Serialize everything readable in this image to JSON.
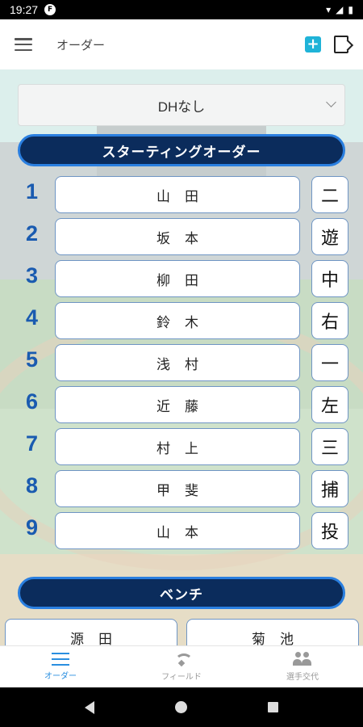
{
  "status_bar": {
    "time": "19:27",
    "app_icon": "F"
  },
  "app_bar": {
    "title": "オーダー"
  },
  "dh_select": {
    "value": "DHなし"
  },
  "starting_header": "スターティングオーダー",
  "lineup": [
    {
      "num": "1",
      "name": "山田",
      "pos": "二"
    },
    {
      "num": "2",
      "name": "坂本",
      "pos": "遊"
    },
    {
      "num": "3",
      "name": "柳田",
      "pos": "中"
    },
    {
      "num": "4",
      "name": "鈴木",
      "pos": "右"
    },
    {
      "num": "5",
      "name": "浅村",
      "pos": "一"
    },
    {
      "num": "6",
      "name": "近藤",
      "pos": "左"
    },
    {
      "num": "7",
      "name": "村上",
      "pos": "三"
    },
    {
      "num": "8",
      "name": "甲斐",
      "pos": "捕"
    },
    {
      "num": "9",
      "name": "山本",
      "pos": "投"
    }
  ],
  "bench_header": "ベンチ",
  "bench": [
    {
      "name": "源田"
    },
    {
      "name": "菊池"
    }
  ],
  "bottom_nav": [
    {
      "label": "オーダー",
      "icon": "list-icon",
      "active": true
    },
    {
      "label": "フィールド",
      "icon": "field-icon",
      "active": false
    },
    {
      "label": "選手交代",
      "icon": "people-icon",
      "active": false
    }
  ],
  "colors": {
    "accent": "#2a8fe0",
    "header_bg": "#0b2c5c",
    "number": "#1a5bb0"
  }
}
